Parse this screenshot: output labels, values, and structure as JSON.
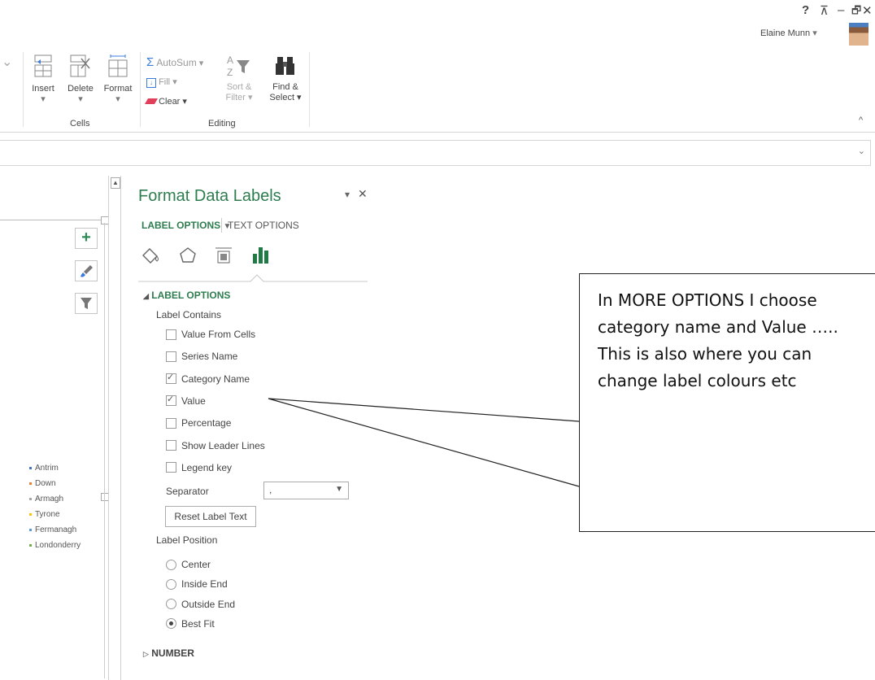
{
  "titlebar": {
    "help_icon": "?",
    "ribbon_display_icon": "⊼",
    "minimize_icon": "–",
    "restore_icon": "🗗",
    "close_icon": "✕",
    "user_name": "Elaine Munn",
    "user_dropdown": "▾"
  },
  "ribbon": {
    "cells_group": {
      "label": "Cells",
      "insert": "Insert",
      "delete": "Delete",
      "format": "Format"
    },
    "editing_group": {
      "label": "Editing",
      "autosum": "AutoSum",
      "fill": "Fill",
      "clear": "Clear",
      "sort_filter_1": "Sort &",
      "sort_filter_2": "Filter",
      "find_select_1": "Find &",
      "find_select_2": "Select"
    },
    "collapse_icon": "^"
  },
  "formula_bar": {
    "expand_icon": "⌄"
  },
  "pane": {
    "title": "Format Data Labels",
    "pin_icon": "▾",
    "close_icon": "✕",
    "tabs": {
      "label_options": "LABEL OPTIONS",
      "label_options_arrow": "▼",
      "text_options": "TEXT OPTIONS"
    },
    "section_label_options": "LABEL OPTIONS",
    "label_contains": "Label Contains",
    "checkboxes": [
      {
        "label": "Value From Cells",
        "checked": false
      },
      {
        "label": "Series Name",
        "checked": false
      },
      {
        "label": "Category Name",
        "checked": true
      },
      {
        "label": "Value",
        "checked": true
      },
      {
        "label": "Percentage",
        "checked": false
      },
      {
        "label": "Show Leader Lines",
        "checked": false
      },
      {
        "label": "Legend key",
        "checked": false
      }
    ],
    "separator_label": "Separator",
    "separator_value": ",",
    "reset_button": "Reset Label Text",
    "label_position": "Label Position",
    "radios": [
      {
        "label": "Center",
        "selected": false
      },
      {
        "label": "Inside End",
        "selected": false
      },
      {
        "label": "Outside End",
        "selected": false
      },
      {
        "label": "Best Fit",
        "selected": true
      }
    ],
    "section_number": "NUMBER"
  },
  "legend": [
    {
      "label": "Antrim",
      "color": "#4472c4"
    },
    {
      "label": "Down",
      "color": "#ed7d31"
    },
    {
      "label": "Armagh",
      "color": "#a5a5a5"
    },
    {
      "label": "Tyrone",
      "color": "#ffc000"
    },
    {
      "label": "Fermanagh",
      "color": "#5b9bd5"
    },
    {
      "label": "Londonderry",
      "color": "#70ad47"
    }
  ],
  "callout": {
    "text": "In MORE OPTIONS I choose category name and Value ….. This is also where you can change label colours etc"
  }
}
